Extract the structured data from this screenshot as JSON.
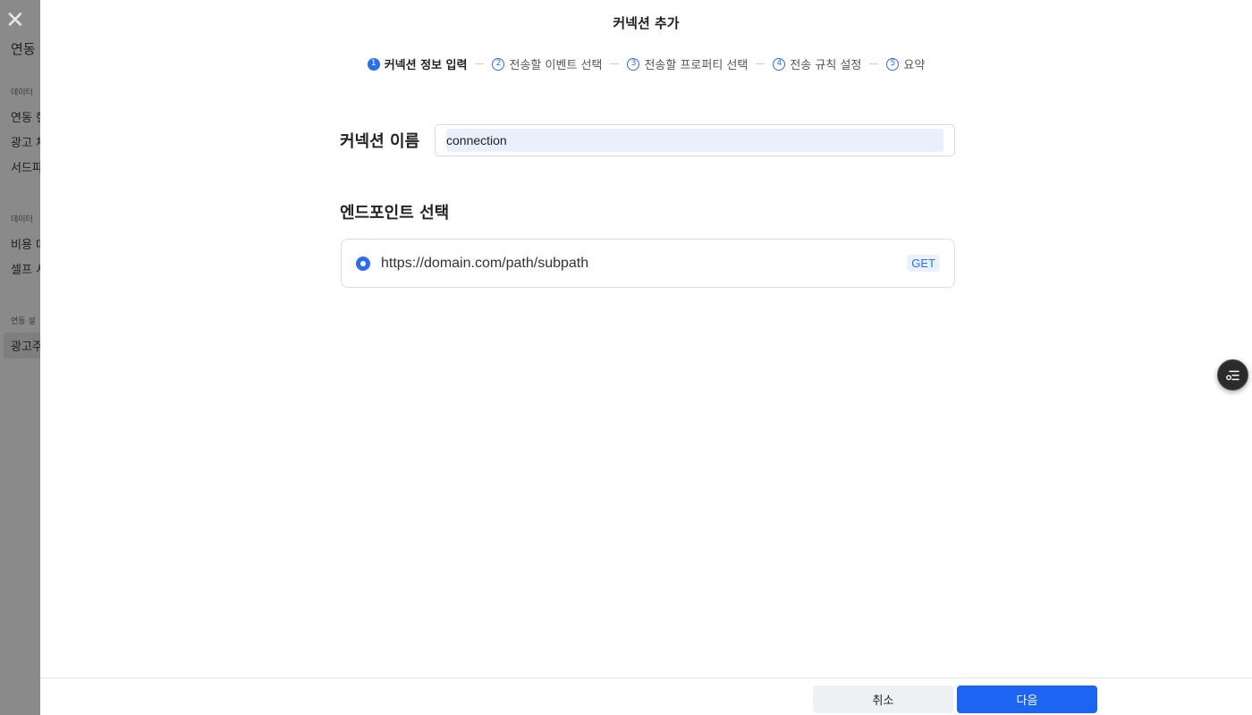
{
  "background": {
    "close_glyph": "✕",
    "title": "연동",
    "sections": [
      {
        "label": "데이터",
        "items": [
          "연동 현",
          "광고 채",
          "서드파"
        ]
      },
      {
        "label": "데이터",
        "items": [
          "비용 데",
          "셀프 서"
        ]
      },
      {
        "label": "연동 설",
        "items": [
          "광고주"
        ]
      }
    ]
  },
  "modal": {
    "title": "커넥션 추가",
    "steps": [
      {
        "num": "1",
        "label": "커넥션 정보 입력"
      },
      {
        "num": "2",
        "label": "전송할 이벤트 선택"
      },
      {
        "num": "3",
        "label": "전송할 프로퍼티 선택"
      },
      {
        "num": "4",
        "label": "전송 규칙 설정"
      },
      {
        "num": "5",
        "label": "요약"
      }
    ],
    "active_step": 1,
    "connection_name_label": "커넥션 이름",
    "connection_name_value": "connection",
    "endpoint_section_title": "엔드포인트 선택",
    "endpoint": {
      "url": "https://domain.com/path/subpath",
      "method": "GET",
      "selected": true
    }
  },
  "footer": {
    "cancel_label": "취소",
    "next_label": "다음"
  },
  "colors": {
    "accent": "#1c64f2",
    "overlay": "#7b7b7b"
  }
}
